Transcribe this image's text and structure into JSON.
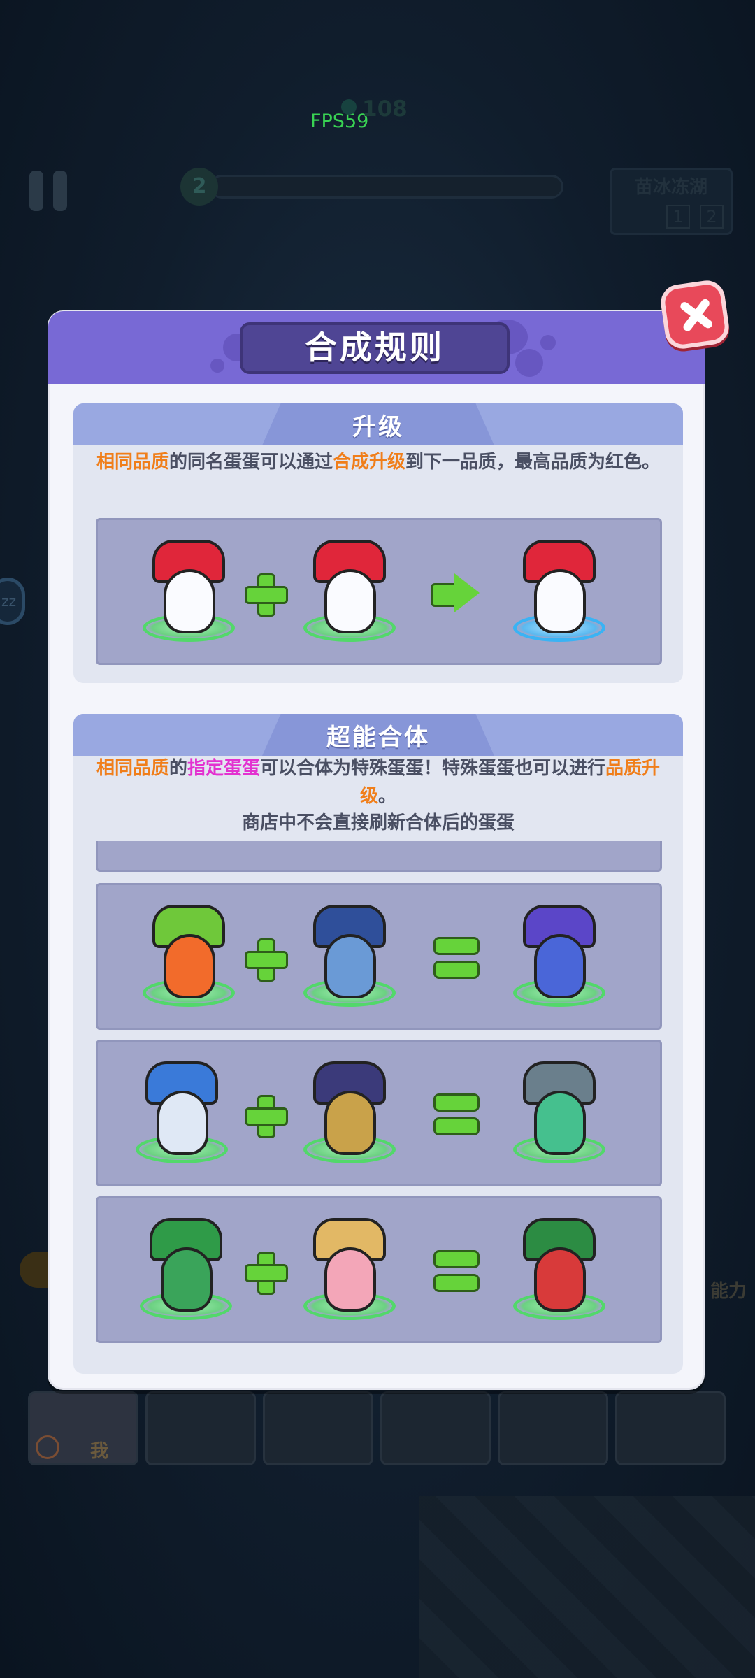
{
  "hud": {
    "fps": "FPS59",
    "gems": "108",
    "wave": "2",
    "stage_name": "苗冰冻湖",
    "stage_page_1": "1",
    "stage_page_2": "2",
    "zz_label": "zz",
    "me_slot_label": "我",
    "right_side_text": "能力"
  },
  "dialog": {
    "title": "合成规则",
    "upgrade": {
      "title": "升级",
      "desc_parts": [
        "相同品质",
        "的同名蛋蛋可以通过",
        "合成升级",
        "到下一品质，最高品质为红色。"
      ]
    },
    "fusion": {
      "title": "超能合体",
      "desc_line1_parts": [
        "相同品质",
        "的",
        "指定蛋蛋",
        "可以合体为特殊蛋蛋！特殊蛋蛋也可以进行",
        "品质升级",
        "。"
      ],
      "desc_line2": "商店中不会直接刷新合体后的蛋蛋",
      "recipes": [
        {
          "a": "clown-egg",
          "b": "police-egg",
          "result": "mech-knight-egg"
        },
        {
          "a": "robot-egg",
          "b": "rambo-egg",
          "result": "cyborg-egg"
        },
        {
          "a": "reindeer-tree-egg",
          "b": "farmer-egg",
          "result": "christmas-egg"
        }
      ]
    }
  },
  "colors": {
    "header_purple": "#7869d5",
    "section_blue": "#99a8e1",
    "highlight_orange": "#f07e1a",
    "highlight_pink": "#e332d0",
    "plus_green": "#66d33a",
    "close_red": "#e8495a"
  }
}
